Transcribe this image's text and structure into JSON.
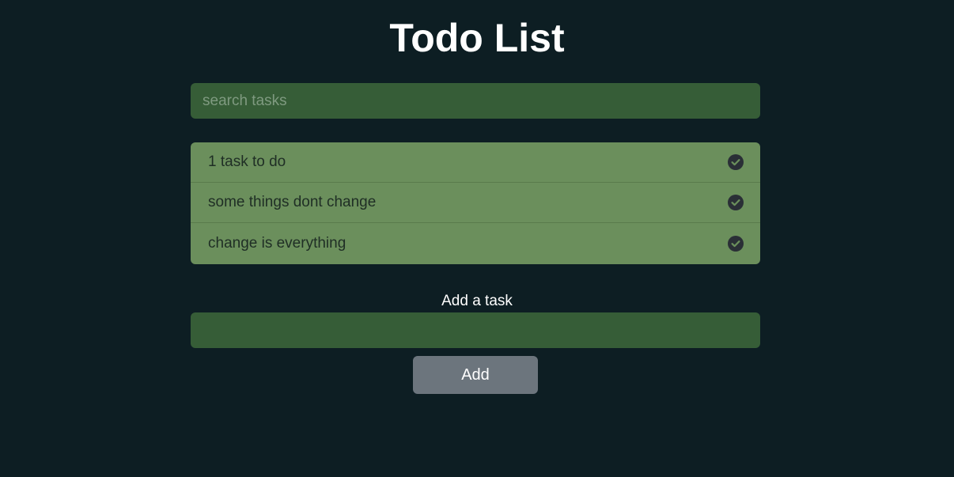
{
  "header": {
    "title": "Todo List"
  },
  "search": {
    "placeholder": "search tasks",
    "value": ""
  },
  "tasks": [
    {
      "text": "1 task to do",
      "icon": "check-circle-icon"
    },
    {
      "text": "some things dont change",
      "icon": "check-circle-icon"
    },
    {
      "text": "change is everything",
      "icon": "check-circle-icon"
    }
  ],
  "add_form": {
    "label": "Add a task",
    "value": "",
    "button_label": "Add"
  },
  "colors": {
    "background": "#0d1e23",
    "input_bg": "#365d37",
    "list_bg": "#6b8f5c",
    "button_bg": "#6c757d",
    "icon": "#2a2f36"
  }
}
